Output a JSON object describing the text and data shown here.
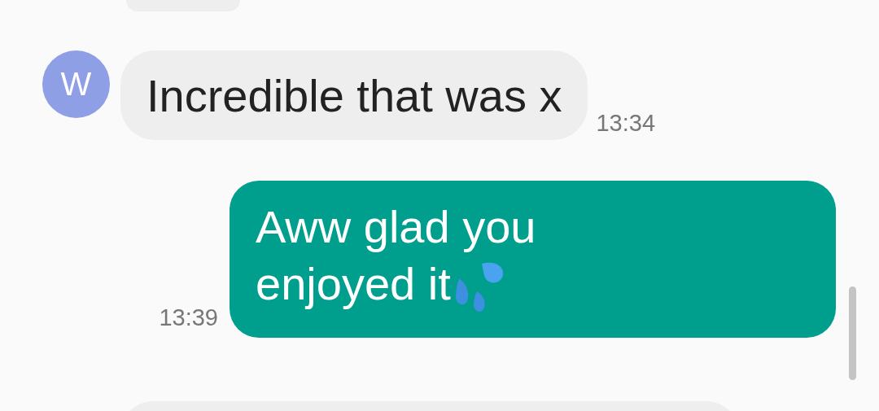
{
  "messages": [
    {
      "kind": "cut"
    },
    {
      "kind": "incoming",
      "avatar": "W",
      "text": "Incredible that was x",
      "time": "13:34"
    },
    {
      "kind": "outgoing",
      "text": "Aww glad you enjoyed it",
      "emoji": true,
      "time": "13:39"
    },
    {
      "kind": "cut"
    }
  ]
}
